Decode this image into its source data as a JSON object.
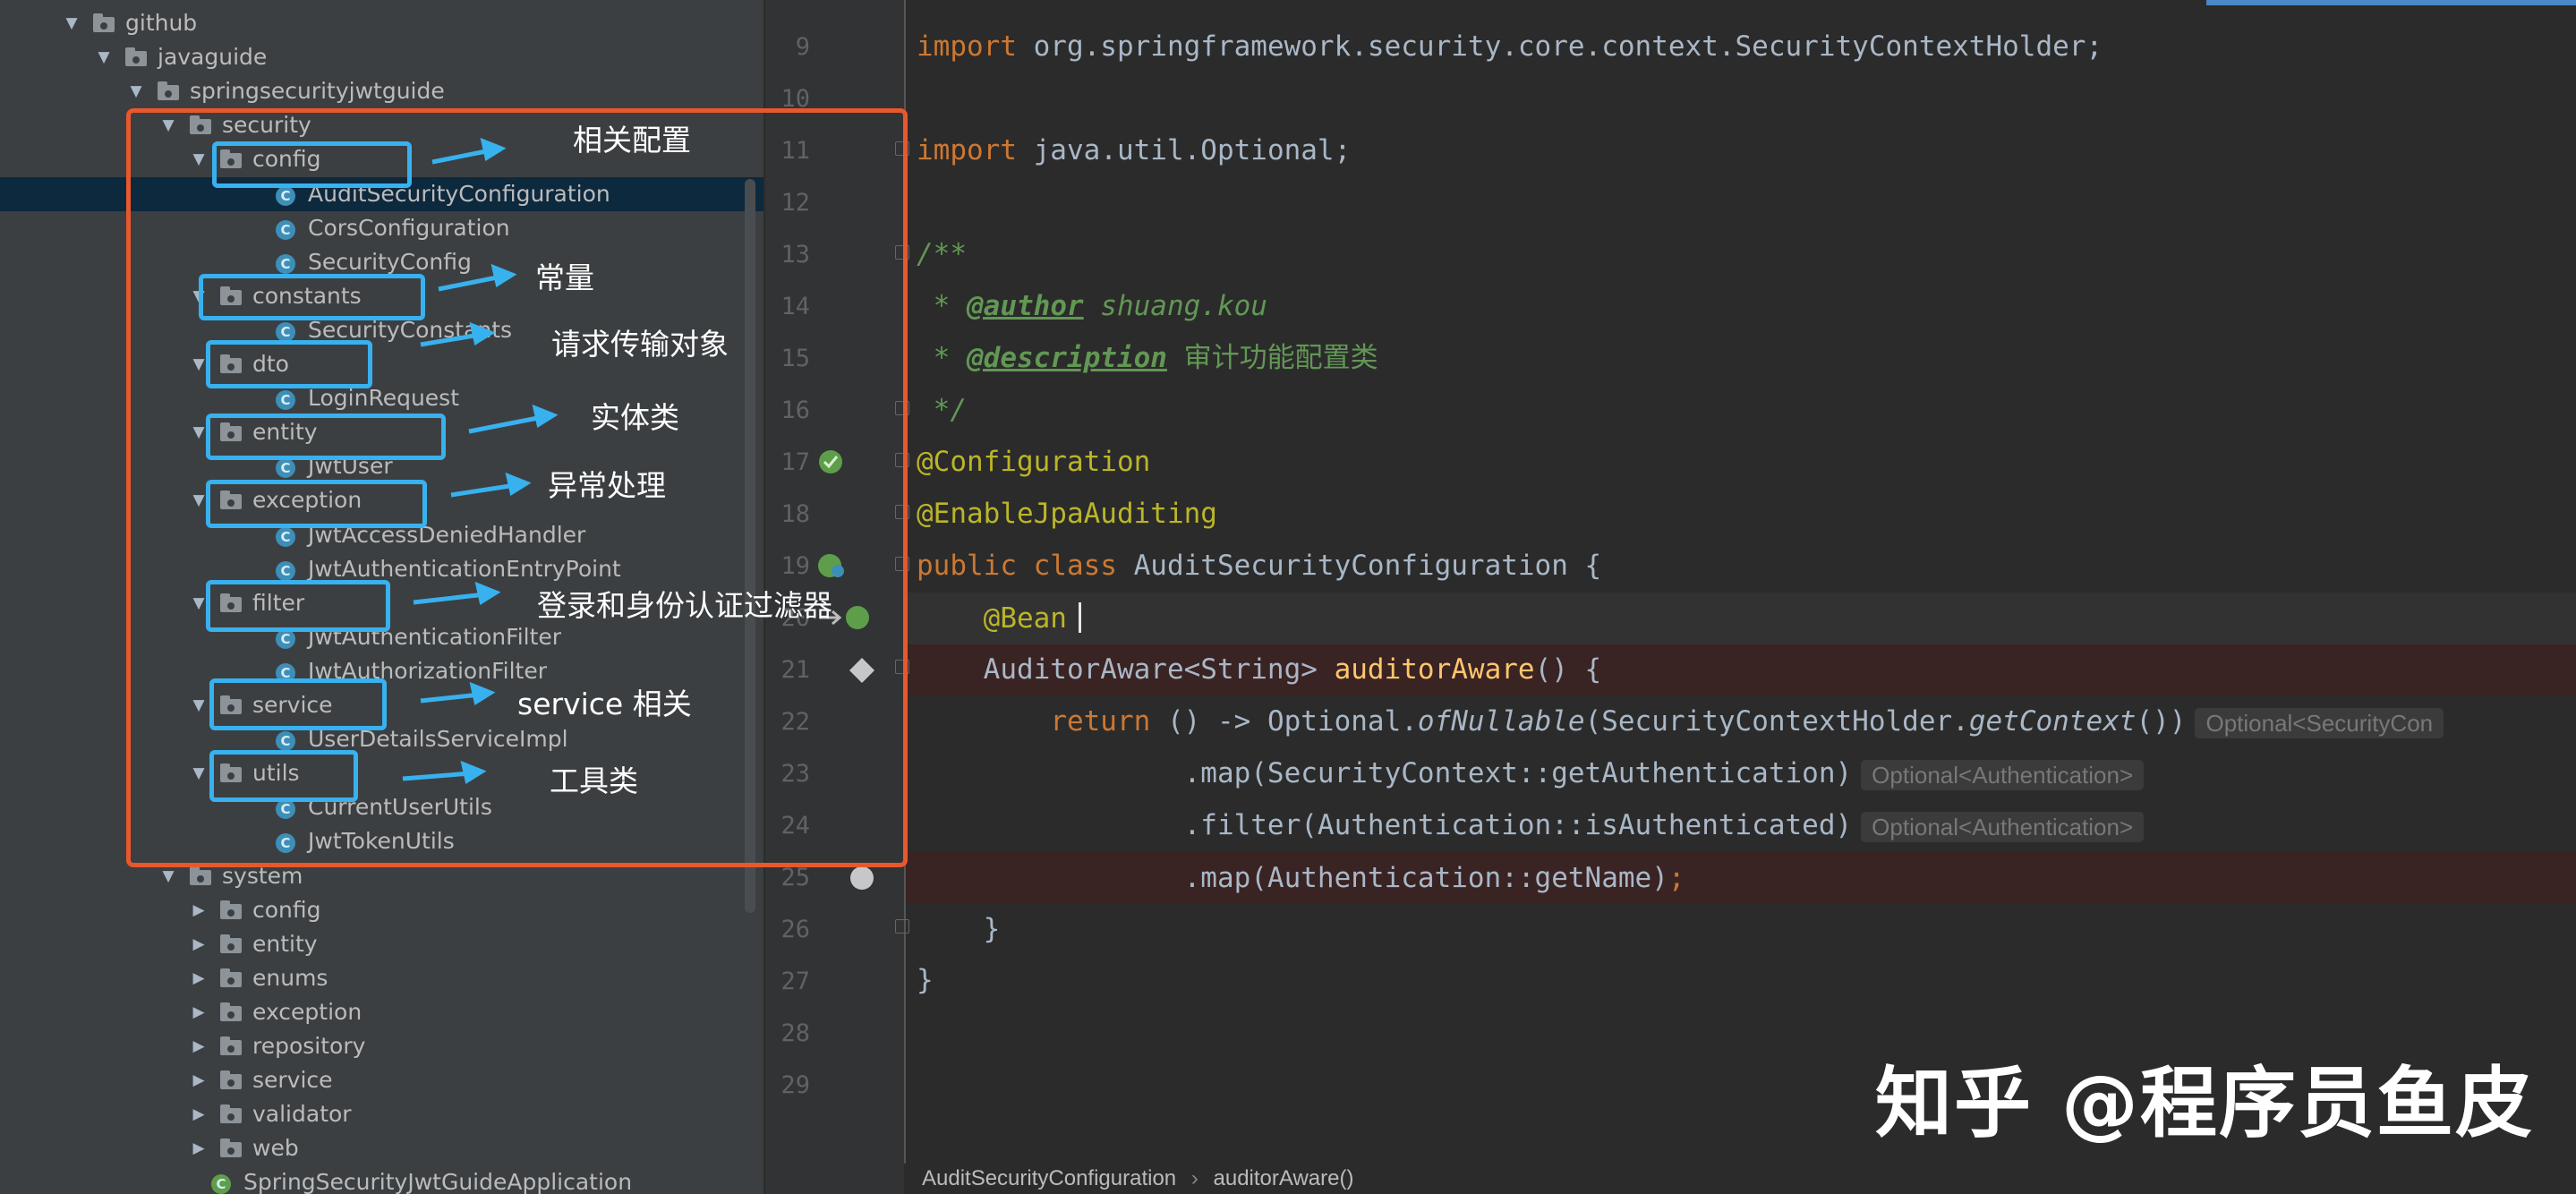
{
  "project_tree": {
    "items": [
      {
        "label": "github",
        "type": "folder",
        "expanded": true
      },
      {
        "label": "javaguide",
        "type": "folder",
        "expanded": true
      },
      {
        "label": "springsecurityjwtguide",
        "type": "folder",
        "expanded": true
      },
      {
        "label": "security",
        "type": "folder",
        "expanded": true
      },
      {
        "label": "config",
        "type": "folder",
        "expanded": true
      },
      {
        "label": "AuditSecurityConfiguration",
        "type": "class",
        "selected": true
      },
      {
        "label": "CorsConfiguration",
        "type": "class"
      },
      {
        "label": "SecurityConfig",
        "type": "class"
      },
      {
        "label": "constants",
        "type": "folder",
        "expanded": true
      },
      {
        "label": "SecurityConstants",
        "type": "class"
      },
      {
        "label": "dto",
        "type": "folder",
        "expanded": true
      },
      {
        "label": "LoginRequest",
        "type": "class"
      },
      {
        "label": "entity",
        "type": "folder",
        "expanded": true
      },
      {
        "label": "JwtUser",
        "type": "class"
      },
      {
        "label": "exception",
        "type": "folder",
        "expanded": true
      },
      {
        "label": "JwtAccessDeniedHandler",
        "type": "class"
      },
      {
        "label": "JwtAuthenticationEntryPoint",
        "type": "class"
      },
      {
        "label": "filter",
        "type": "folder",
        "expanded": true
      },
      {
        "label": "JwtAuthenticationFilter",
        "type": "class"
      },
      {
        "label": "JwtAuthorizationFilter",
        "type": "class"
      },
      {
        "label": "service",
        "type": "folder",
        "expanded": true
      },
      {
        "label": "UserDetailsServiceImpl",
        "type": "class"
      },
      {
        "label": "utils",
        "type": "folder",
        "expanded": true
      },
      {
        "label": "CurrentUserUtils",
        "type": "class"
      },
      {
        "label": "JwtTokenUtils",
        "type": "class"
      },
      {
        "label": "system",
        "type": "folder",
        "expanded": true
      },
      {
        "label": "config",
        "type": "folder",
        "expanded": false
      },
      {
        "label": "entity",
        "type": "folder",
        "expanded": false
      },
      {
        "label": "enums",
        "type": "folder",
        "expanded": false
      },
      {
        "label": "exception",
        "type": "folder",
        "expanded": false
      },
      {
        "label": "repository",
        "type": "folder",
        "expanded": false
      },
      {
        "label": "service",
        "type": "folder",
        "expanded": false
      },
      {
        "label": "validator",
        "type": "folder",
        "expanded": false
      },
      {
        "label": "web",
        "type": "folder",
        "expanded": false
      },
      {
        "label": "SpringSecurityJwtGuideApplication",
        "type": "app"
      }
    ]
  },
  "annotations": {
    "config": "相关配置",
    "constants": "常量",
    "dto": "请求传输对象",
    "entity": "实体类",
    "exception": "异常处理",
    "filter": "登录和身份认证过滤器",
    "service": "service 相关",
    "utils": "工具类"
  },
  "editor": {
    "line_numbers": [
      "9",
      "10",
      "11",
      "12",
      "13",
      "14",
      "15",
      "16",
      "17",
      "18",
      "19",
      "20",
      "21",
      "22",
      "23",
      "24",
      "25",
      "26",
      "27",
      "28",
      "29"
    ],
    "code": {
      "l9_kw": "import",
      "l9_rest": " org.springframework.security.core.context.SecurityContextHolder;",
      "l11_kw": "import",
      "l11_rest": " java.util.Optional;",
      "l13": "/**",
      "l14_star": " * ",
      "l14_tag": "@author",
      "l14_val": " shuang.kou",
      "l15_star": " * ",
      "l15_tag": "@description",
      "l15_val": " 审计功能配置类",
      "l16": " */",
      "l17": "@Configuration",
      "l18": "@EnableJpaAuditing",
      "l19_kw": "public class",
      "l19_rest": " AuditSecurityConfiguration {",
      "l20": "    @Bean",
      "l21_type": "    AuditorAware<String> ",
      "l21_fn": "auditorAware",
      "l21_rest": "() {",
      "l22_indent": "        ",
      "l22_kw": "return",
      "l22_a": " () -> Optional.",
      "l22_it1": "ofNullable",
      "l22_b": "(SecurityContextHolder.",
      "l22_it2": "getContext",
      "l22_c": "())",
      "l23": "                .map(SecurityContext::getAuthentication)",
      "l24": "                .filter(Authentication::isAuthenticated)",
      "l25_a": "                .map(Authentication::getName)",
      "l25_b": ";",
      "l26": "    }",
      "l27": "}"
    },
    "hints": {
      "l22": "Optional<SecurityCon",
      "l23": "Optional<Authentication>",
      "l24": "Optional<Authentication>"
    }
  },
  "breadcrumb": {
    "file": "AuditSecurityConfiguration",
    "sep": "›",
    "method": "auditorAware()"
  },
  "watermark": "知乎 @程序员鱼皮",
  "colors": {
    "annotation_box": "#38b1ef",
    "red_frame": "#e8582c",
    "keyword": "#cc7832",
    "annotation_code": "#bbb529",
    "comment": "#629755",
    "function": "#ffc66d",
    "tree_bg": "#3c3f41",
    "editor_bg": "#2b2b2b"
  }
}
